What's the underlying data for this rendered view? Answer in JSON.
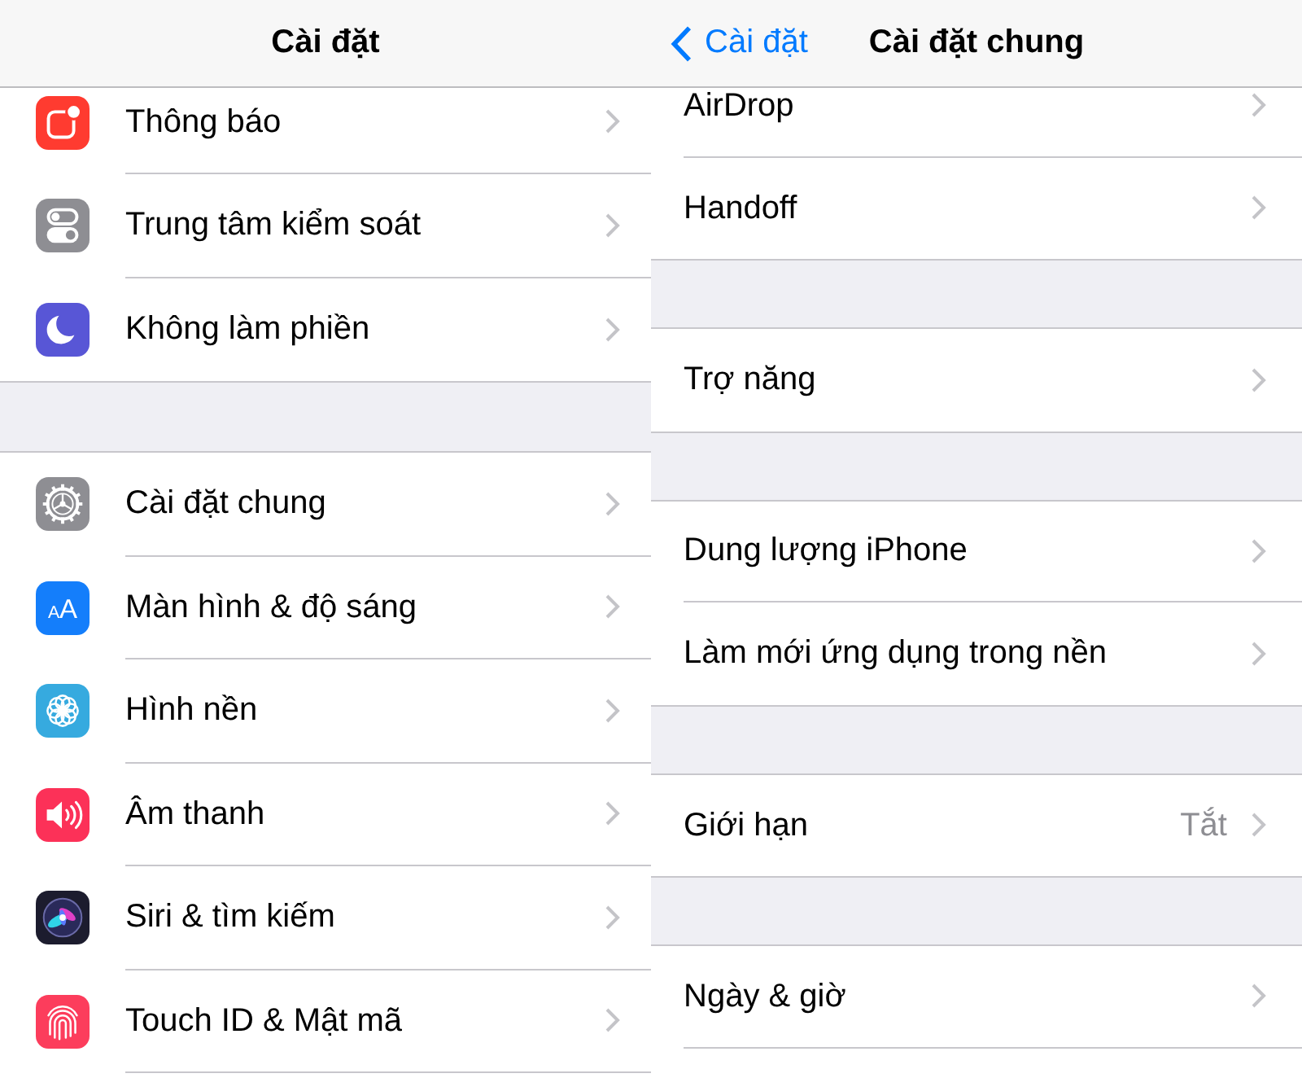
{
  "screens": [
    {
      "nav_bar": {
        "title": "Cài đặt"
      },
      "groups": [
        {
          "items": [
            {
              "label": "Thông báo",
              "color": "#ff3b30"
            },
            {
              "label": "Trung tâm kiểm soát",
              "color": "#8e8e93"
            },
            {
              "label": "Không làm phiền",
              "color": "#5856d6"
            }
          ]
        },
        {
          "items": [
            {
              "label": "Cài đặt chung",
              "color": "#8e8e93"
            },
            {
              "label": "Màn hình & độ sáng",
              "color": "#147efb",
              "icon_text": "AA"
            },
            {
              "label": "Hình nền",
              "color": "#36aadf"
            },
            {
              "label": "Âm thanh",
              "color": "#fc3158"
            },
            {
              "label": "Siri & tìm kiếm",
              "color": "#1c1c2e"
            },
            {
              "label": "Touch ID & Mật mã",
              "color": "#fc3d5c"
            }
          ]
        }
      ]
    },
    {
      "nav_bar": {
        "back": "Cài đặt",
        "title": "Cài đặt chung"
      },
      "groups": [
        {
          "items": [
            {
              "label": "AirDrop"
            },
            {
              "label": "Handoff"
            }
          ]
        },
        {
          "items": [
            {
              "label": "Trợ năng"
            }
          ]
        },
        {
          "items": [
            {
              "label": "Dung lượng iPhone"
            },
            {
              "label": "Làm mới ứng dụng trong nền"
            }
          ]
        },
        {
          "items": [
            {
              "label": "Giới hạn",
              "value": "Tắt"
            }
          ]
        },
        {
          "items": [
            {
              "label": "Ngày & giờ"
            }
          ]
        }
      ]
    }
  ]
}
